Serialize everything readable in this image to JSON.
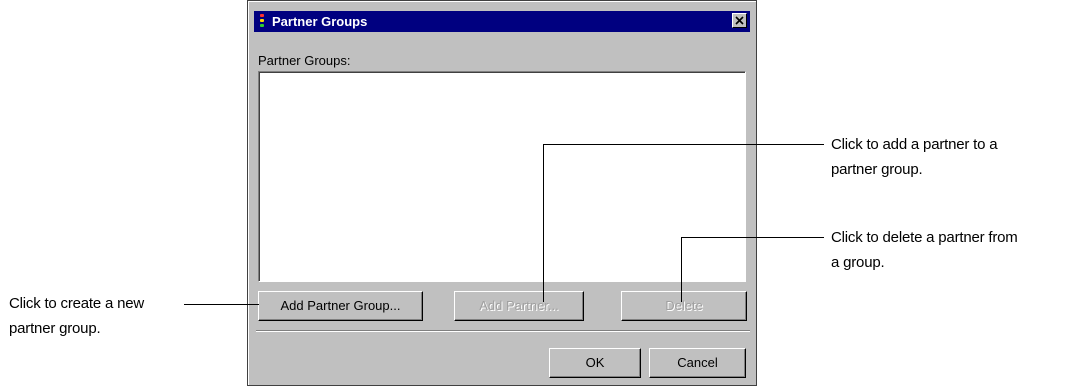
{
  "dialog": {
    "title": "Partner Groups",
    "list_label": "Partner Groups:",
    "buttons": {
      "add_group": "Add Partner Group...",
      "add_partner": "Add Partner...",
      "delete": "Delete",
      "ok": "OK",
      "cancel": "Cancel"
    },
    "disabled_buttons": [
      "Add Partner...",
      "Delete"
    ],
    "close_icon": "close-icon",
    "app_icon": "traffic-light-icon",
    "colors": {
      "titlebar": "#000080",
      "face": "#c0c0c0",
      "disabled_text": "#a0a0a0"
    }
  },
  "callouts": {
    "add_group": {
      "line1": "Click to create a new",
      "line2": "partner group."
    },
    "add_partner": {
      "line1": "Click to add a partner to a",
      "line2": "partner group."
    },
    "delete": {
      "line1": "Click to delete a partner from",
      "line2": "a group."
    }
  }
}
